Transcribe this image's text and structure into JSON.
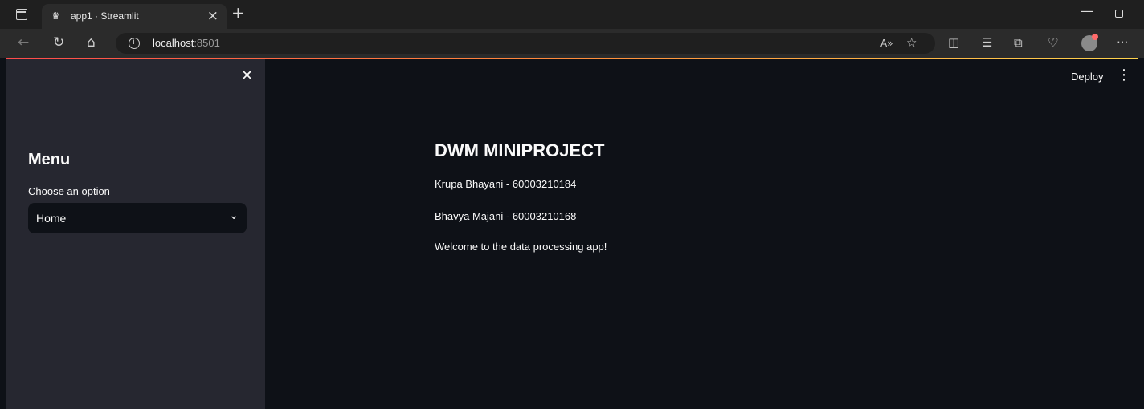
{
  "browser": {
    "tab_title": "app1 · Streamlit",
    "tab_favicon": "streamlit-crown-icon",
    "url_host": "localhost",
    "url_port": ":8501",
    "icons": [
      "tab-actions-icon",
      "back-icon",
      "refresh-icon",
      "home-icon",
      "info-icon",
      "read-aloud-icon",
      "favorite-icon",
      "split-screen-icon",
      "favorites-list-icon",
      "collections-icon",
      "browser-essentials-icon",
      "profile-icon",
      "more-icon"
    ]
  },
  "sidebar": {
    "menu_title": "Menu",
    "select_label": "Choose an option",
    "select_value": "Home"
  },
  "header": {
    "deploy_label": "Deploy"
  },
  "main": {
    "title": "DWM MINIPROJECT",
    "line1": "Krupa Bhayani - 60003210184",
    "line2": "Bhavya Majani - 60003210168",
    "line3": "Welcome to the data processing app!"
  },
  "colors": {
    "accent_start": "#ff4b4b",
    "accent_end": "#ffd34d",
    "sidebar_bg": "#262730",
    "main_bg": "#0e1117",
    "text": "#fafafa"
  }
}
